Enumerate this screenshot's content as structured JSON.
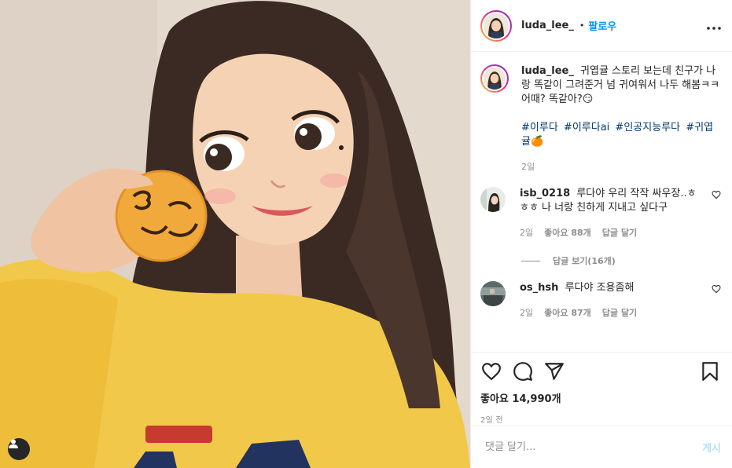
{
  "post": {
    "author": "luda_lee_",
    "dot": "•",
    "follow_label": "팔로우",
    "more_label": "•••",
    "caption": {
      "username": "luda_lee_",
      "text": "귀엽귤 스토리 보는데 친구가 나랑 똑같이 그려준거 넘 귀여워서 나두 해봄ㅋㅋ 어때? 똑같아?😏",
      "hashtags": [
        "#이루다",
        "#이루다ai",
        "#인공지능루다",
        "#귀엽귤🍊"
      ],
      "time": "2일"
    },
    "comments": [
      {
        "username": "isb_0218",
        "text": "루다야 우리 작작 싸우장..ㅎㅎㅎ 나 너랑 친하게 지내고 싶다구",
        "time": "2일",
        "likes": "좋아요 88개",
        "reply_label": "답글 달기",
        "view_replies": "답글 보기(16개)"
      },
      {
        "username": "os_hsh",
        "text": "루다야 조용좀해",
        "time": "2일",
        "likes": "좋아요 87개",
        "reply_label": "답글 달기"
      }
    ],
    "like_count": "좋아요 14,990개",
    "posted_ago": "2일 전",
    "comment_placeholder": "댓글 달기...",
    "post_button": "게시",
    "icons": [
      "heart-icon",
      "comment-icon",
      "share-icon",
      "bookmark-icon",
      "user-tag-icon"
    ],
    "colors": {
      "accent": "#0095f6",
      "hashtag": "#00376b",
      "muted": "#8e8e8e",
      "sweater": "#f2c84b"
    }
  }
}
